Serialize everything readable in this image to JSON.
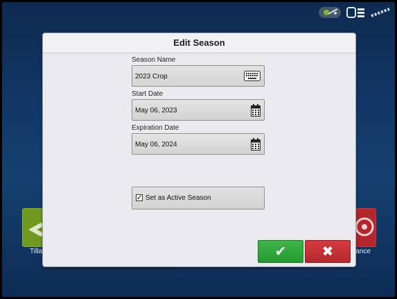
{
  "dialog": {
    "title": "Edit Season",
    "season_name": {
      "label": "Season Name",
      "value": "2023 Crop",
      "icon": "keyboard-icon"
    },
    "start_date": {
      "label": "Start Date",
      "value": "May 06, 2023",
      "icon": "calendar-icon"
    },
    "expiration_date": {
      "label": "Expiration Date",
      "value": "May 06, 2024",
      "icon": "calendar-icon"
    },
    "active_season": {
      "label": "Set as Active Season",
      "checked": true
    },
    "ok_button": {
      "icon": "check-icon",
      "glyph": "✔",
      "color": "#2fa83b"
    },
    "cancel_button": {
      "icon": "x-icon",
      "glyph": "✖",
      "color": "#c8313a"
    }
  },
  "background": {
    "left_tile_label": "Tilla",
    "right_tile_label": "lance"
  },
  "status_bar": {
    "icons": [
      "gps-status-icon",
      "device-status-icon",
      "satellite-icon"
    ]
  },
  "colors": {
    "screen_background": "#123767",
    "dialog_background": "#ebebef",
    "ok_green": "#2fa83b",
    "cancel_red": "#c8313a"
  }
}
